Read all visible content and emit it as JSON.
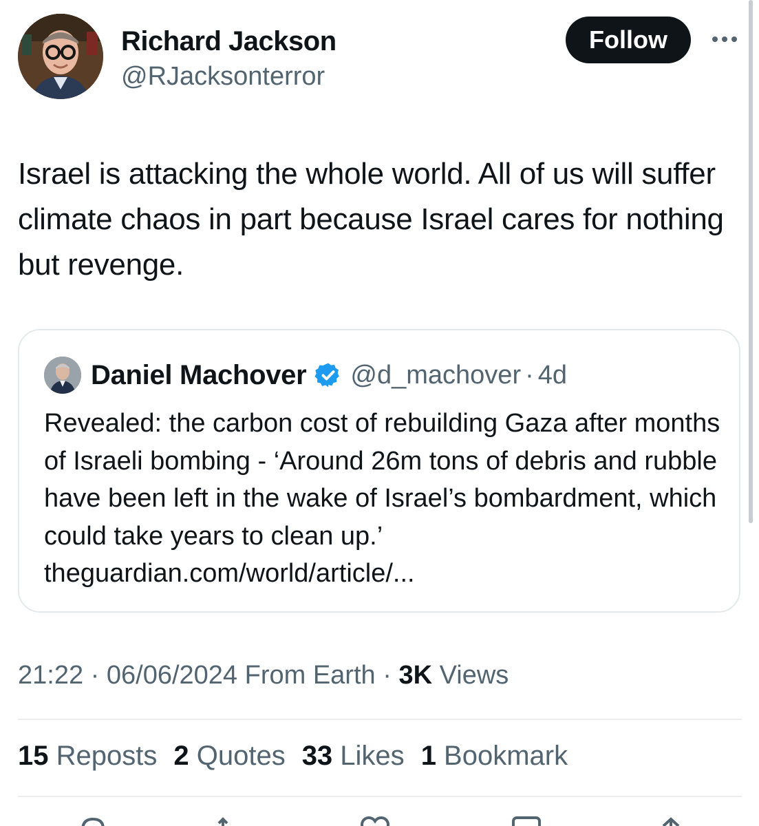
{
  "tweet": {
    "author": {
      "name": "Richard Jackson",
      "handle": "@RJacksonterror",
      "avatar_icon": "profile-photo"
    },
    "follow_label": "Follow",
    "more_icon": "more-dots-icon",
    "text": "Israel is attacking the whole world. All of us will suffer climate chaos in part because Israel cares for nothing but revenge."
  },
  "quote": {
    "author_name": "Daniel Machover",
    "verified_icon": "verified-badge-icon",
    "handle": "@d_machover",
    "separator": "·",
    "age": "4d",
    "text": "Revealed: the carbon cost of rebuilding Gaza after months of Israeli bombing - ‘Around 26m tons of debris and rubble have been left in the wake of Israel’s bombardment, which could take years to clean up.’ theguardian.com/world/article/..."
  },
  "meta": {
    "time": "21:22",
    "dot1": " · ",
    "date": "06/06/2024",
    "source": " From Earth",
    "dot2": " · ",
    "views_count": "3K",
    "views_label": " Views"
  },
  "stats": {
    "reposts": {
      "count": "15",
      "label": " Reposts"
    },
    "quotes": {
      "count": "2",
      "label": " Quotes"
    },
    "likes": {
      "count": "33",
      "label": " Likes"
    },
    "bookmarks": {
      "count": "1",
      "label": " Bookmark"
    }
  },
  "actions": [
    "reply-icon",
    "repost-icon",
    "like-icon",
    "bookmark-icon",
    "share-icon"
  ],
  "colors": {
    "text": "#0f1419",
    "secondary": "#536471",
    "verified": "#1d9bf0",
    "follow_bg": "#0f1419",
    "border": "#e6e9ec"
  }
}
